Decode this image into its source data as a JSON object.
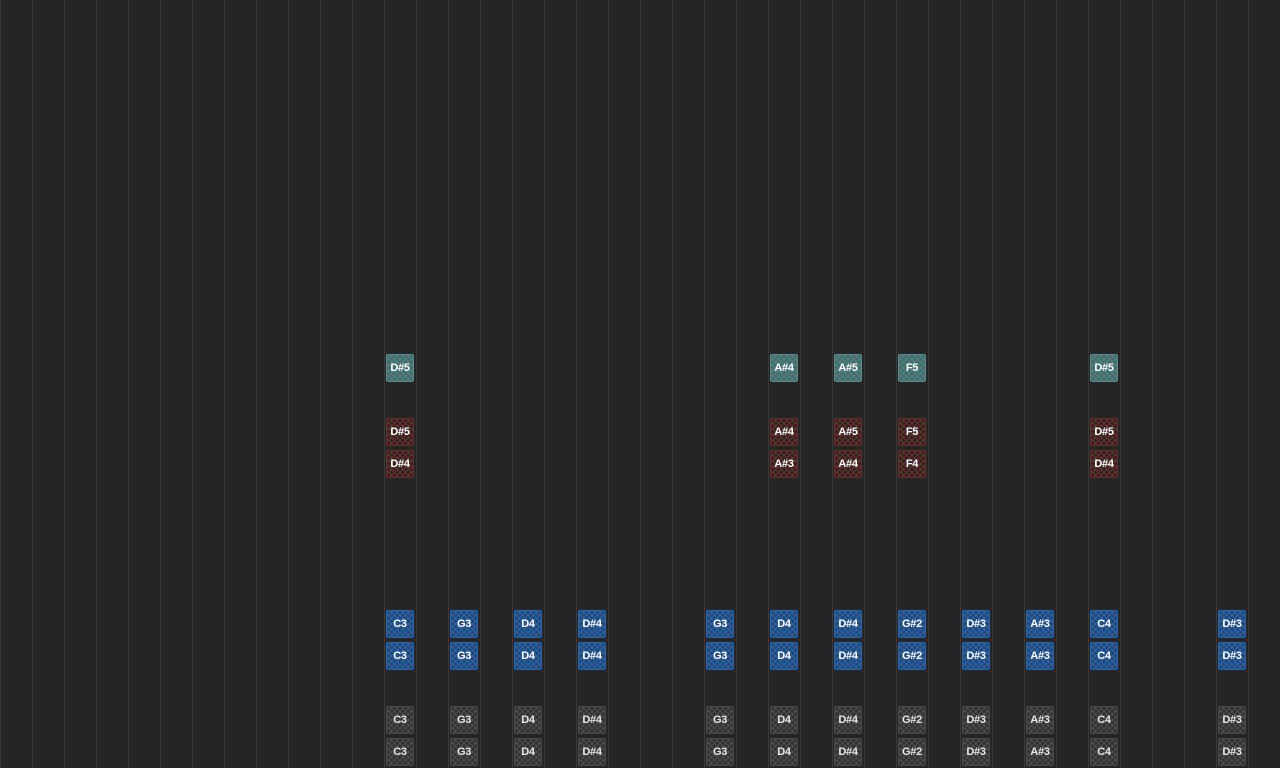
{
  "rows": {
    "teal": {
      "color": "#3f6d6d",
      "notes": [
        {
          "col": 12,
          "label": "D#5"
        },
        {
          "col": 24,
          "label": "A#4"
        },
        {
          "col": 26,
          "label": "A#5"
        },
        {
          "col": 28,
          "label": "F5"
        },
        {
          "col": 34,
          "label": "D#5"
        }
      ]
    },
    "red_top": {
      "color": "#3d1d1a",
      "notes": [
        {
          "col": 12,
          "label": "D#5"
        },
        {
          "col": 24,
          "label": "A#4"
        },
        {
          "col": 26,
          "label": "A#5"
        },
        {
          "col": 28,
          "label": "F5"
        },
        {
          "col": 34,
          "label": "D#5"
        }
      ]
    },
    "red_bottom": {
      "color": "#3d1d1a",
      "notes": [
        {
          "col": 12,
          "label": "D#4"
        },
        {
          "col": 24,
          "label": "A#3"
        },
        {
          "col": 26,
          "label": "A#4"
        },
        {
          "col": 28,
          "label": "F4"
        },
        {
          "col": 34,
          "label": "D#4"
        }
      ]
    },
    "blue_top": {
      "color": "#1a4a85",
      "notes": [
        {
          "col": 12,
          "label": "C3"
        },
        {
          "col": 14,
          "label": "G3"
        },
        {
          "col": 16,
          "label": "D4"
        },
        {
          "col": 18,
          "label": "D#4"
        },
        {
          "col": 22,
          "label": "G3"
        },
        {
          "col": 24,
          "label": "D4"
        },
        {
          "col": 26,
          "label": "D#4"
        },
        {
          "col": 28,
          "label": "G#2"
        },
        {
          "col": 30,
          "label": "D#3"
        },
        {
          "col": 32,
          "label": "A#3"
        },
        {
          "col": 34,
          "label": "C4"
        },
        {
          "col": 38,
          "label": "D#3"
        }
      ]
    },
    "blue_bottom": {
      "color": "#1a4a85",
      "notes": [
        {
          "col": 12,
          "label": "C3"
        },
        {
          "col": 14,
          "label": "G3"
        },
        {
          "col": 16,
          "label": "D4"
        },
        {
          "col": 18,
          "label": "D#4"
        },
        {
          "col": 22,
          "label": "G3"
        },
        {
          "col": 24,
          "label": "D4"
        },
        {
          "col": 26,
          "label": "D#4"
        },
        {
          "col": 28,
          "label": "G#2"
        },
        {
          "col": 30,
          "label": "D#3"
        },
        {
          "col": 32,
          "label": "A#3"
        },
        {
          "col": 34,
          "label": "C4"
        },
        {
          "col": 38,
          "label": "D#3"
        }
      ]
    },
    "gray_top": {
      "color": "#333336",
      "notes": [
        {
          "col": 12,
          "label": "C3"
        },
        {
          "col": 14,
          "label": "G3"
        },
        {
          "col": 16,
          "label": "D4"
        },
        {
          "col": 18,
          "label": "D#4"
        },
        {
          "col": 22,
          "label": "G3"
        },
        {
          "col": 24,
          "label": "D4"
        },
        {
          "col": 26,
          "label": "D#4"
        },
        {
          "col": 28,
          "label": "G#2"
        },
        {
          "col": 30,
          "label": "D#3"
        },
        {
          "col": 32,
          "label": "A#3"
        },
        {
          "col": 34,
          "label": "C4"
        },
        {
          "col": 38,
          "label": "D#3"
        }
      ]
    },
    "gray_bottom": {
      "color": "#333336",
      "notes": [
        {
          "col": 12,
          "label": "C3"
        },
        {
          "col": 14,
          "label": "G3"
        },
        {
          "col": 16,
          "label": "D4"
        },
        {
          "col": 18,
          "label": "D#4"
        },
        {
          "col": 22,
          "label": "G3"
        },
        {
          "col": 24,
          "label": "D4"
        },
        {
          "col": 26,
          "label": "D#4"
        },
        {
          "col": 28,
          "label": "G#2"
        },
        {
          "col": 30,
          "label": "D#3"
        },
        {
          "col": 32,
          "label": "A#3"
        },
        {
          "col": 34,
          "label": "C4"
        },
        {
          "col": 38,
          "label": "D#3"
        }
      ]
    }
  }
}
